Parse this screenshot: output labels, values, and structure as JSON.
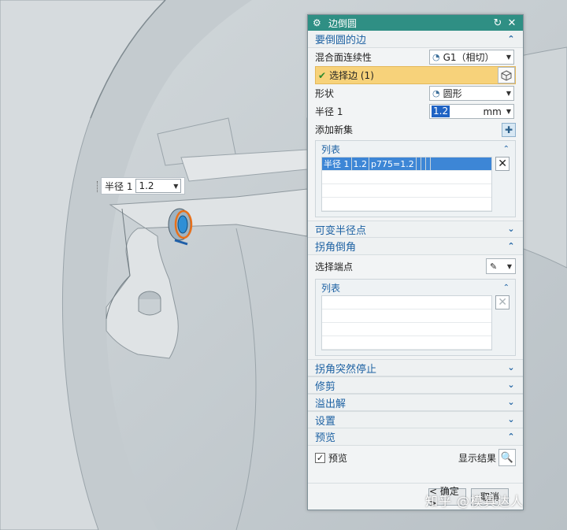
{
  "mini_field": {
    "label": "半径 1",
    "value": "1.2"
  },
  "dialog": {
    "title": "边倒圆",
    "sections": {
      "edges": {
        "title": "要倒圆的边",
        "continuity_label": "混合面连续性",
        "continuity_value": "G1（相切）",
        "select_edge_label": "选择边 (1)",
        "shape_label": "形状",
        "shape_value": "圆形",
        "radius_label": "半径 1",
        "radius_value": "1.2",
        "radius_unit": "mm",
        "add_set_label": "添加新集",
        "list_title": "列表",
        "list_rows": [
          {
            "name": "半径 1",
            "value": "1.2",
            "expr": "p775=1.2"
          }
        ]
      },
      "variable_radius": {
        "title": "可变半径点"
      },
      "corner_setback": {
        "title": "拐角倒角",
        "select_endpoint_label": "选择端点",
        "list_title": "列表"
      },
      "corner_stop": {
        "title": "拐角突然停止"
      },
      "trim": {
        "title": "修剪"
      },
      "overflow": {
        "title": "溢出解"
      },
      "settings": {
        "title": "设置"
      },
      "preview": {
        "title": "预览",
        "checkbox_label": "预览",
        "show_result_label": "显示结果"
      }
    },
    "buttons": {
      "ok": "< 确定 >",
      "cancel": "取消"
    }
  },
  "watermark": "知乎 @模具达人",
  "colors": {
    "title_bar": "#2f8f84",
    "section_text": "#1e62a3",
    "selection_highlight": "#f7d27a",
    "list_selected": "#3d86d6"
  }
}
